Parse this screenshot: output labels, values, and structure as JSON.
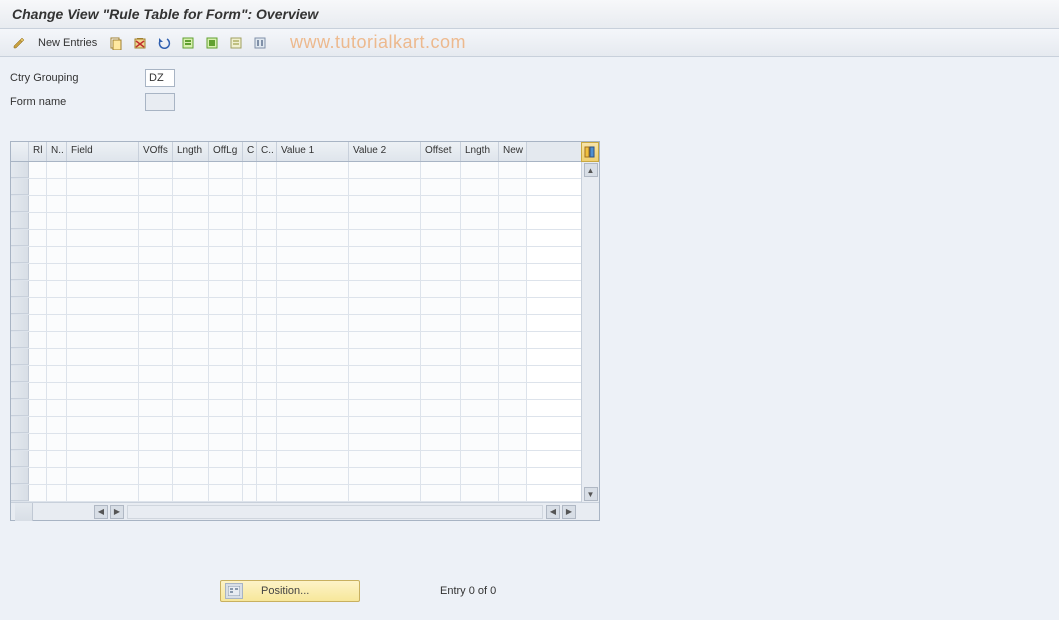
{
  "title": "Change View \"Rule Table for Form\": Overview",
  "watermark": "www.tutorialkart.com",
  "toolbar": {
    "new_entries_label": "New Entries"
  },
  "form": {
    "ctry_grouping_label": "Ctry Grouping",
    "ctry_grouping_value": "DZ",
    "form_name_label": "Form name",
    "form_name_value": ""
  },
  "table": {
    "columns": [
      "Rl",
      "N..",
      "Field",
      "VOffs",
      "Lngth",
      "OffLg",
      "C",
      "C..",
      "Value 1",
      "Value 2",
      "Offset",
      "Lngth",
      "New"
    ],
    "rows": [
      {},
      {},
      {},
      {},
      {},
      {},
      {},
      {},
      {},
      {},
      {},
      {},
      {},
      {},
      {},
      {},
      {},
      {},
      {},
      {}
    ]
  },
  "footer": {
    "position_label": "Position...",
    "entry_status": "Entry 0 of 0"
  }
}
